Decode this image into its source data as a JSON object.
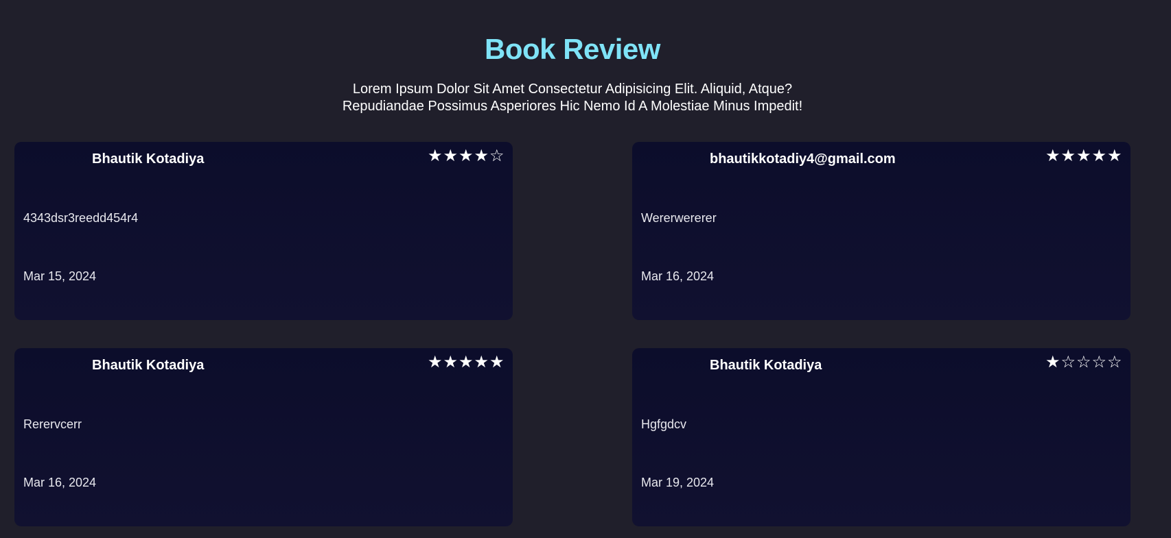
{
  "header": {
    "title": "Book Review",
    "subtitle_line1": "Lorem Ipsum Dolor Sit Amet Consectetur Adipisicing Elit. Aliquid, Atque?",
    "subtitle_line2": "Repudiandae Possimus Asperiores Hic Nemo Id A Molestiae Minus Impedit!"
  },
  "reviews": [
    {
      "name": "Bhautik Kotadiya",
      "rating": 4,
      "max_rating": 5,
      "comment": "4343dsr3reedd454r4",
      "date": "Mar 15, 2024"
    },
    {
      "name": "bhautikkotadiy4@gmail.com",
      "rating": 5,
      "max_rating": 5,
      "comment": "Wererwererer",
      "date": "Mar 16, 2024"
    },
    {
      "name": "Bhautik Kotadiya",
      "rating": 5,
      "max_rating": 5,
      "comment": "Rerervcerr",
      "date": "Mar 16, 2024"
    },
    {
      "name": "Bhautik Kotadiya",
      "rating": 1,
      "max_rating": 5,
      "comment": "Hgfgdcv",
      "date": "Mar 19, 2024"
    }
  ],
  "icons": {
    "star_filled": "star-filled-icon",
    "star_empty": "star-empty-icon"
  },
  "colors": {
    "background": "#201f2b",
    "card": "#0e0f2d",
    "title_accent": "#7fe3f7",
    "text": "#ffffff"
  }
}
